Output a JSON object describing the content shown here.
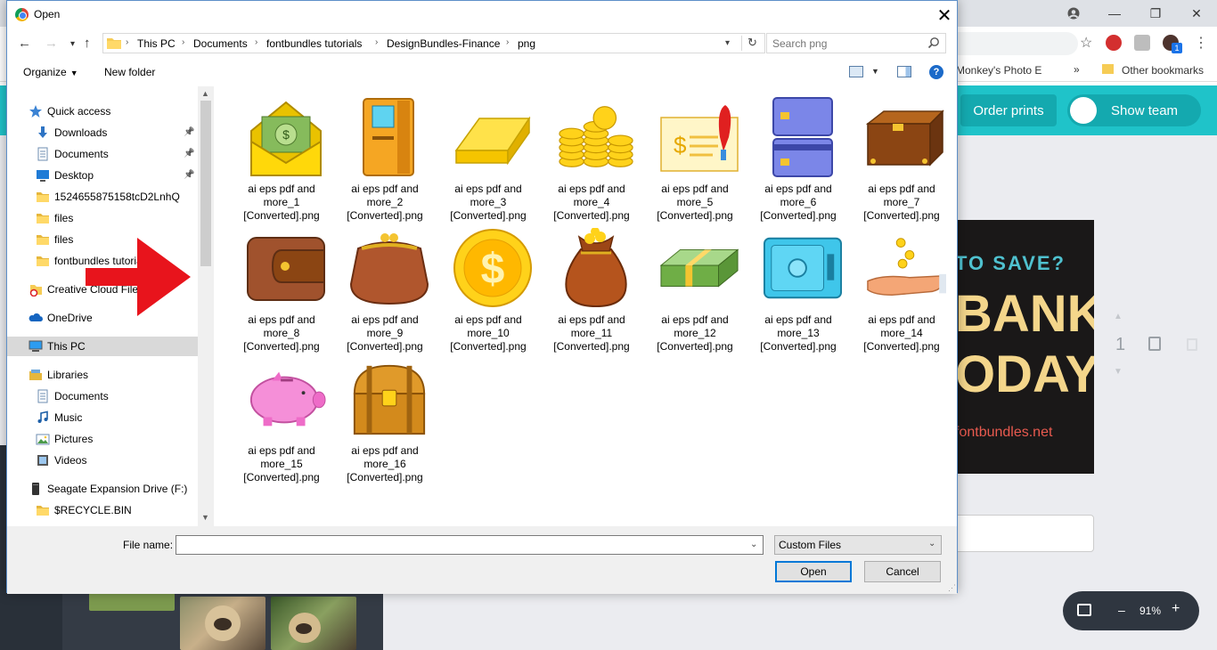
{
  "browser": {
    "bookmarks": {
      "item_partial": "Monkey's Photo E",
      "more": "»",
      "other": "Other bookmarks"
    },
    "header": {
      "order_prints": "Order prints",
      "show_team": "Show team"
    },
    "design": {
      "line1": "TO SAVE?",
      "line2": "BANK",
      "line3": "ODAY!",
      "line4": "fontbundles.net"
    },
    "page_number": "1",
    "zoom": {
      "minus": "–",
      "value": "91%",
      "plus": "+"
    },
    "extension_badge": "1"
  },
  "dialog": {
    "title": "Open",
    "close_glyph": "✕",
    "breadcrumb": [
      "This PC",
      "Documents",
      "fontbundles tutorials",
      "DesignBundles-Finance",
      "png"
    ],
    "search_placeholder": "Search png",
    "toolbar": {
      "organize": "Organize",
      "new_folder": "New folder",
      "help": "?"
    },
    "nav": [
      {
        "label": "Quick access",
        "icon": "star-icon",
        "pinned": false
      },
      {
        "label": "Downloads",
        "icon": "download-icon",
        "pinned": true
      },
      {
        "label": "Documents",
        "icon": "documents-icon",
        "pinned": true
      },
      {
        "label": "Desktop",
        "icon": "desktop-icon",
        "pinned": true
      },
      {
        "label": "1524655875158tcD2LnhQ",
        "icon": "folder-icon",
        "pinned": false
      },
      {
        "label": "files",
        "icon": "folder-icon",
        "pinned": false
      },
      {
        "label": "files",
        "icon": "folder-icon",
        "pinned": false
      },
      {
        "label": "fontbundles tutorials",
        "icon": "folder-icon",
        "pinned": false
      },
      {
        "label": "Creative Cloud Files",
        "icon": "creative-cloud-icon",
        "pinned": false
      },
      {
        "label": "OneDrive",
        "icon": "onedrive-icon",
        "pinned": false
      },
      {
        "label": "This PC",
        "icon": "computer-icon",
        "pinned": false,
        "selected": true
      },
      {
        "label": "Libraries",
        "icon": "libraries-icon",
        "pinned": false
      },
      {
        "label": "Documents",
        "icon": "documents-icon",
        "pinned": false
      },
      {
        "label": "Music",
        "icon": "music-icon",
        "pinned": false
      },
      {
        "label": "Pictures",
        "icon": "pictures-icon",
        "pinned": false
      },
      {
        "label": "Videos",
        "icon": "videos-icon",
        "pinned": false
      },
      {
        "label": "Seagate Expansion Drive (F:)",
        "icon": "drive-icon",
        "pinned": false
      },
      {
        "label": "$RECYCLE.BIN",
        "icon": "folder-icon",
        "pinned": false
      }
    ],
    "files": [
      {
        "name": "ai eps pdf and more_1 [Converted].png",
        "icon": "money-envelope-icon"
      },
      {
        "name": "ai eps pdf and more_2 [Converted].png",
        "icon": "atm-icon"
      },
      {
        "name": "ai eps pdf and more_3 [Converted].png",
        "icon": "gold-bar-icon"
      },
      {
        "name": "ai eps pdf and more_4 [Converted].png",
        "icon": "coin-stacks-icon"
      },
      {
        "name": "ai eps pdf and more_5 [Converted].png",
        "icon": "cheque-icon"
      },
      {
        "name": "ai eps pdf and more_6 [Converted].png",
        "icon": "credit-cards-icon"
      },
      {
        "name": "ai eps pdf and more_7 [Converted].png",
        "icon": "briefcase-icon"
      },
      {
        "name": "ai eps pdf and more_8 [Converted].png",
        "icon": "wallet-icon"
      },
      {
        "name": "ai eps pdf and more_9 [Converted].png",
        "icon": "purse-icon"
      },
      {
        "name": "ai eps pdf and more_10 [Converted].png",
        "icon": "dollar-coin-icon"
      },
      {
        "name": "ai eps pdf and more_11 [Converted].png",
        "icon": "money-bag-icon"
      },
      {
        "name": "ai eps pdf and more_12 [Converted].png",
        "icon": "banknote-stack-icon"
      },
      {
        "name": "ai eps pdf and more_13 [Converted].png",
        "icon": "safe-icon"
      },
      {
        "name": "ai eps pdf and more_14 [Converted].png",
        "icon": "hand-coins-icon"
      },
      {
        "name": "ai eps pdf and more_15 [Converted].png",
        "icon": "piggy-bank-icon"
      },
      {
        "name": "ai eps pdf and more_16 [Converted].png",
        "icon": "treasure-chest-icon"
      }
    ],
    "file_name_label": "File name:",
    "file_name_value": "",
    "file_type": "Custom Files",
    "open_label": "Open",
    "cancel_label": "Cancel"
  },
  "colors": {
    "canva_teal": "#1fc3c9",
    "dialog_border": "#5d8fc9",
    "arrow_red": "#e8141c",
    "selection": "#d9d9d9"
  }
}
